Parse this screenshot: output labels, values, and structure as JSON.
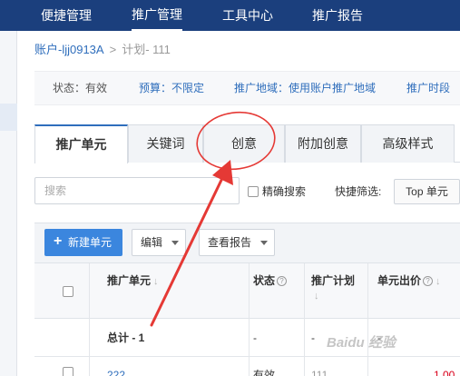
{
  "topnav": {
    "items": [
      {
        "label": "便捷管理"
      },
      {
        "label": "推广管理"
      },
      {
        "label": "工具中心"
      },
      {
        "label": "推广报告"
      }
    ]
  },
  "breadcrumb": {
    "account": "账户-ljj0913A",
    "separator": ">",
    "plan": "计划- 111"
  },
  "infobar": {
    "status": "状态：有效",
    "budget": "预算：不限定",
    "region": "推广地域：使用账户推广地域",
    "schedule": "推广时段"
  },
  "tabs": [
    {
      "label": "推广单元"
    },
    {
      "label": "关键词"
    },
    {
      "label": "创意"
    },
    {
      "label": "附加创意"
    },
    {
      "label": "高级样式"
    }
  ],
  "filter": {
    "search_placeholder": "搜索",
    "exact_label": "精确搜索",
    "quick_label": "快捷筛选:",
    "top_unit_label": "Top 单元"
  },
  "toolbar": {
    "new_unit": "新建单元",
    "edit": "编辑",
    "view_report": "查看报告"
  },
  "table": {
    "headers": {
      "unit": "推广单元",
      "status": "状态",
      "plan": "推广计划",
      "bid": "单元出价"
    },
    "total": {
      "label": "总计 - 1",
      "status": "-",
      "plan": "-",
      "bid": "-"
    },
    "rows": [
      {
        "unit": "222",
        "status": "有效",
        "plan": "111",
        "bid": "1.00"
      }
    ]
  },
  "colors": {
    "nav_bg": "#1b3f7d",
    "link": "#2f6ebc",
    "primary_button": "#3b86de",
    "annotation": "#e53935"
  },
  "watermark": "Baidu 经验"
}
